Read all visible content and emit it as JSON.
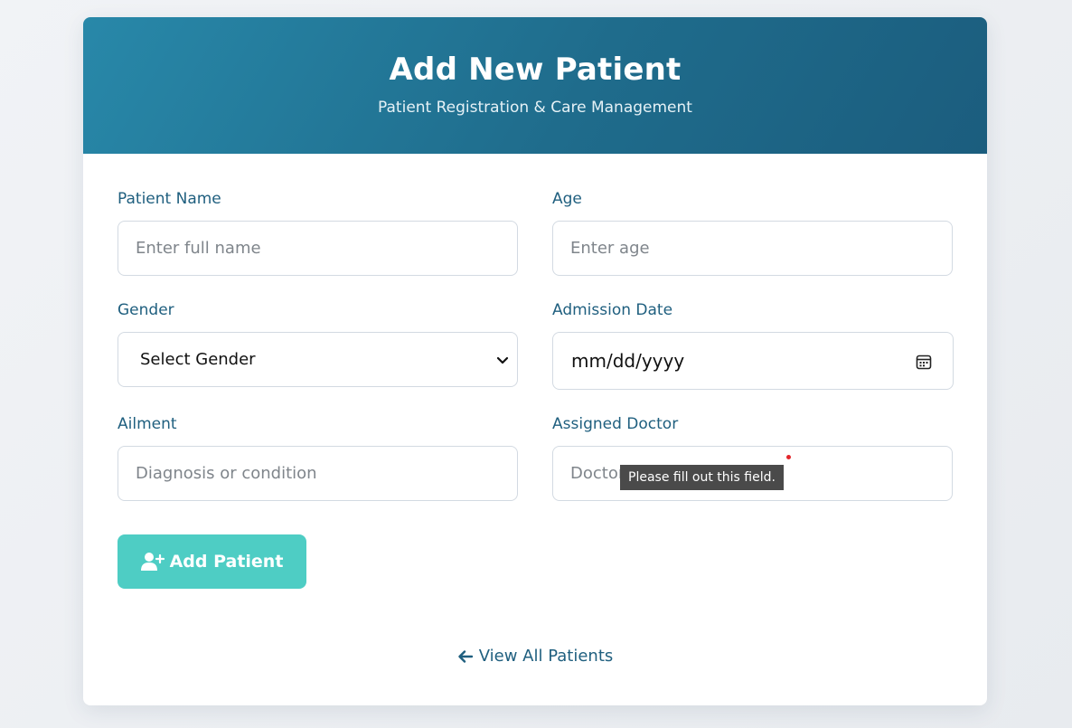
{
  "header": {
    "title": "Add New Patient",
    "subtitle": "Patient Registration & Care Management"
  },
  "form": {
    "patient_name": {
      "label": "Patient Name",
      "placeholder": "Enter full name",
      "value": ""
    },
    "age": {
      "label": "Age",
      "placeholder": "Enter age",
      "value": ""
    },
    "gender": {
      "label": "Gender",
      "selected": "Select Gender"
    },
    "admission_date": {
      "label": "Admission Date",
      "placeholder": "mm/dd/yyyy"
    },
    "ailment": {
      "label": "Ailment",
      "placeholder": "Diagnosis or condition",
      "value": ""
    },
    "assigned_doctor": {
      "label": "Assigned Doctor",
      "placeholder": "Doctor",
      "value": ""
    },
    "validation_tooltip": "Please fill out this field."
  },
  "actions": {
    "submit_label": "Add Patient",
    "submit_icon": "user-plus-icon",
    "view_all_label": "View All Patients",
    "view_all_icon": "arrow-left-icon"
  },
  "colors": {
    "header_start": "#2888a9",
    "header_end": "#1b5d7e",
    "label": "#1f5f7f",
    "button": "#4ecdc4"
  }
}
